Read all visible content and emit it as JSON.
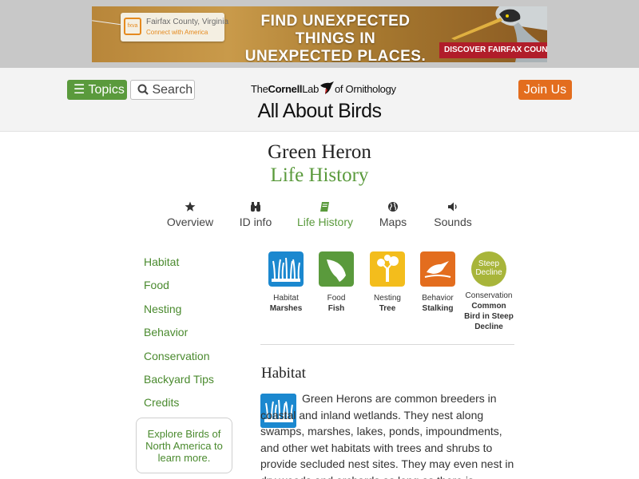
{
  "ad": {
    "tag_line1": "Fairfax County, Virginia",
    "tag_line2": "Connect with America",
    "tag_logo": "fxva",
    "headline": "FIND UNEXPECTED THINGS IN UNEXPECTED PLACES.",
    "cta": "DISCOVER FAIRFAX COUNTY!"
  },
  "header": {
    "topics_label": "Topics",
    "search_label": "Search",
    "join_label": "Join Us",
    "cornell_the": "The",
    "cornell_name": "Cornell",
    "cornell_lab": "Lab",
    "cornell_of": "of Ornithology",
    "site_title": "All About Birds"
  },
  "species": {
    "name": "Green Heron",
    "page": "Life History"
  },
  "tabs": [
    {
      "label": "Overview",
      "icon": "star-icon"
    },
    {
      "label": "ID info",
      "icon": "binoculars-icon"
    },
    {
      "label": "Life History",
      "icon": "book-icon",
      "active": true
    },
    {
      "label": "Maps",
      "icon": "globe-icon"
    },
    {
      "label": "Sounds",
      "icon": "speaker-icon"
    }
  ],
  "sidebar": {
    "items": [
      "Habitat",
      "Food",
      "Nesting",
      "Behavior",
      "Conservation",
      "Backyard Tips",
      "Credits"
    ],
    "explore": "Explore Birds of North America to learn more."
  },
  "facts": [
    {
      "label": "Habitat",
      "value": "Marshes",
      "icon": "marsh-icon",
      "color": "#1b88cf"
    },
    {
      "label": "Food",
      "value": "Fish",
      "icon": "fish-icon",
      "color": "#5a9a3c"
    },
    {
      "label": "Nesting",
      "value": "Tree",
      "icon": "tree-icon",
      "color": "#f3bd1c"
    },
    {
      "label": "Behavior",
      "value": "Stalking",
      "icon": "stalking-bird-icon",
      "color": "#e36d1e"
    },
    {
      "label": "Conservation",
      "value": "Common Bird in Steep Decline",
      "badge": "Steep Decline",
      "color": "#a8b53a"
    }
  ],
  "habitat": {
    "heading": "Habitat",
    "text": "Green Herons are common breeders in coastal and inland wetlands. They nest along swamps, marshes, lakes, ponds, impoundments, and other wet habitats with trees and shrubs to provide secluded nest sites. They may even nest in dry woods and orchards as long as there is"
  }
}
